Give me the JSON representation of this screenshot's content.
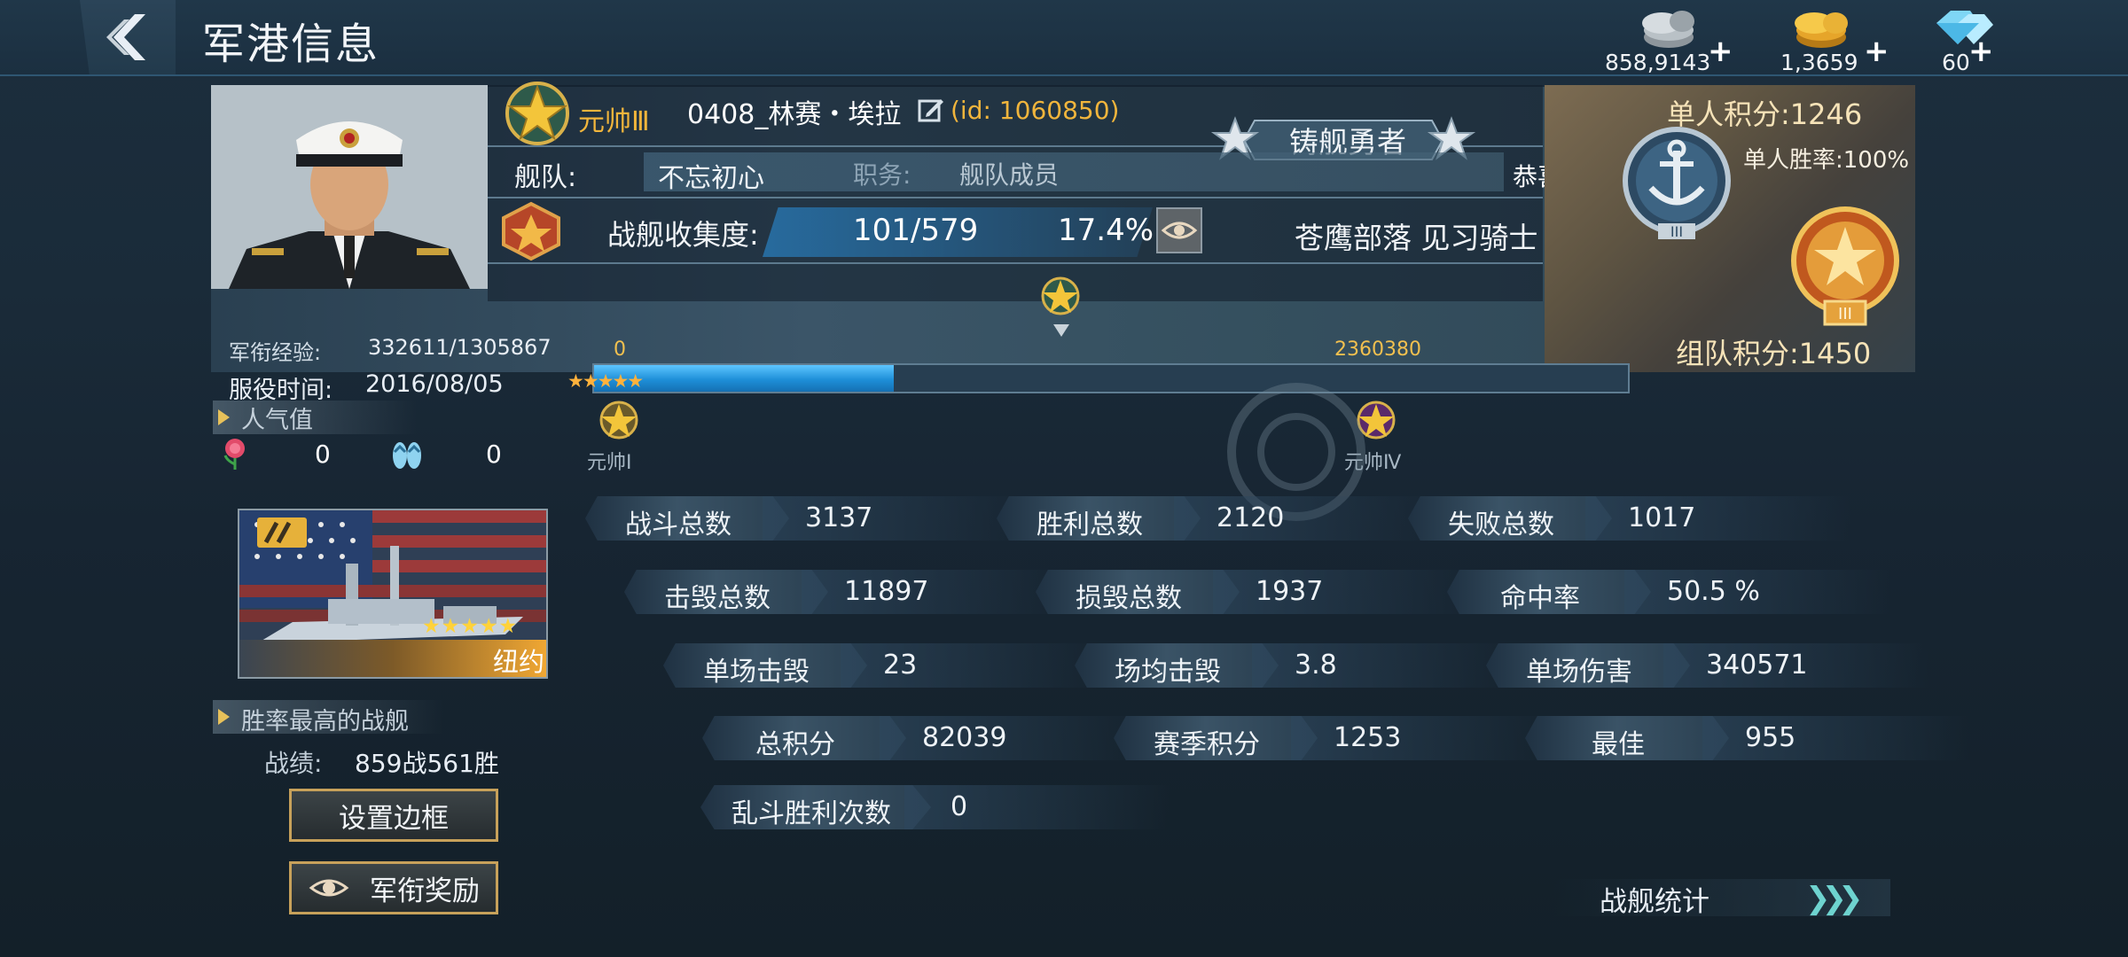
{
  "header": {
    "title": "军港信息"
  },
  "currencies": [
    {
      "icon": "silver-coin-icon",
      "value": "858,9143"
    },
    {
      "icon": "gold-coin-icon",
      "value": "1,3659"
    },
    {
      "icon": "diamond-icon",
      "value": "60"
    }
  ],
  "profile": {
    "rank_name": "元帅Ⅲ",
    "player_name": "0408_林赛・埃拉",
    "player_id": "(id: 1060850)",
    "title_badge": "铸舰勇者",
    "fleet_label": "舰队:",
    "fleet_name": "不忘初心",
    "duty_label": "职务:",
    "duty_value": "舰队成员",
    "congrats_text": "恭喜",
    "collection_label": "战舰收集度:",
    "collection_count": "101/579",
    "collection_percent": "17.4%",
    "tribe_title": "苍鹰部落 见习骑士",
    "solo_score": "单人积分:1246",
    "solo_win_rate": "单人胜率:100%",
    "team_score": "组队积分:1450",
    "exp_label": "军衔经验:",
    "exp_value": "332611/1305867",
    "service_label": "服役时间:",
    "service_value": "2016/08/05"
  },
  "progress": {
    "start_value": "0",
    "end_value": "2360380",
    "fill_fraction": 0.29,
    "stars": "★★★★★",
    "left_rank_label": "元帅Ⅰ",
    "right_rank_label": "元帅Ⅳ"
  },
  "popularity": {
    "label": "人气值",
    "rose_count": "0",
    "flipflop_count": "0"
  },
  "best_ship": {
    "ship_name": "纽约",
    "stars": "★★★★★",
    "section_label": "胜率最高的战舰",
    "record_label": "战绩:",
    "record_value": "859战561胜"
  },
  "buttons": {
    "set_frame": "设置边框",
    "rank_reward": "军衔奖励"
  },
  "stats": [
    {
      "label": "战斗总数",
      "value": "3137"
    },
    {
      "label": "胜利总数",
      "value": "2120"
    },
    {
      "label": "失败总数",
      "value": "1017"
    },
    {
      "label": "击毁总数",
      "value": "11897"
    },
    {
      "label": "损毁总数",
      "value": "1937"
    },
    {
      "label": "命中率",
      "value": "50.5 %"
    },
    {
      "label": "单场击毁",
      "value": "23"
    },
    {
      "label": "场均击毁",
      "value": "3.8"
    },
    {
      "label": "单场伤害",
      "value": "340571"
    },
    {
      "label": "总积分",
      "value": "82039"
    },
    {
      "label": "赛季积分",
      "value": "1253"
    },
    {
      "label": "最佳",
      "value": "955"
    },
    {
      "label": "乱斗胜利次数",
      "value": "0"
    }
  ],
  "fleet_stats": {
    "label": "战舰统计"
  }
}
